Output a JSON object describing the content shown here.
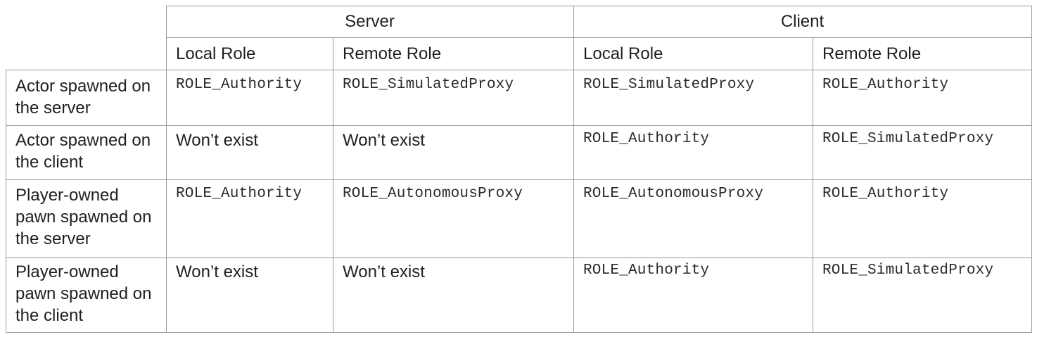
{
  "table": {
    "group_headers": [
      "Server",
      "Client"
    ],
    "sub_headers": [
      "Local Role",
      "Remote Role",
      "Local Role",
      "Remote Role"
    ],
    "rows": [
      {
        "label": "Actor spawned on the server",
        "cells": [
          "ROLE_Authority",
          "ROLE_SimulatedProxy",
          "ROLE_SimulatedProxy",
          "ROLE_Authority"
        ]
      },
      {
        "label": "Actor spawned on the client",
        "cells": [
          "Won’t exist",
          "Won’t exist",
          "ROLE_Authority",
          "ROLE_SimulatedProxy"
        ]
      },
      {
        "label": "Player-owned pawn spawned on the server",
        "cells": [
          "ROLE_Authority",
          "ROLE_AutonomousProxy",
          "ROLE_AutonomousProxy",
          "ROLE_Authority"
        ]
      },
      {
        "label": "Player-owned pawn spawned on the client",
        "cells": [
          "Won’t exist",
          "Won’t exist",
          "ROLE_Authority",
          "ROLE_SimulatedProxy"
        ]
      }
    ]
  }
}
